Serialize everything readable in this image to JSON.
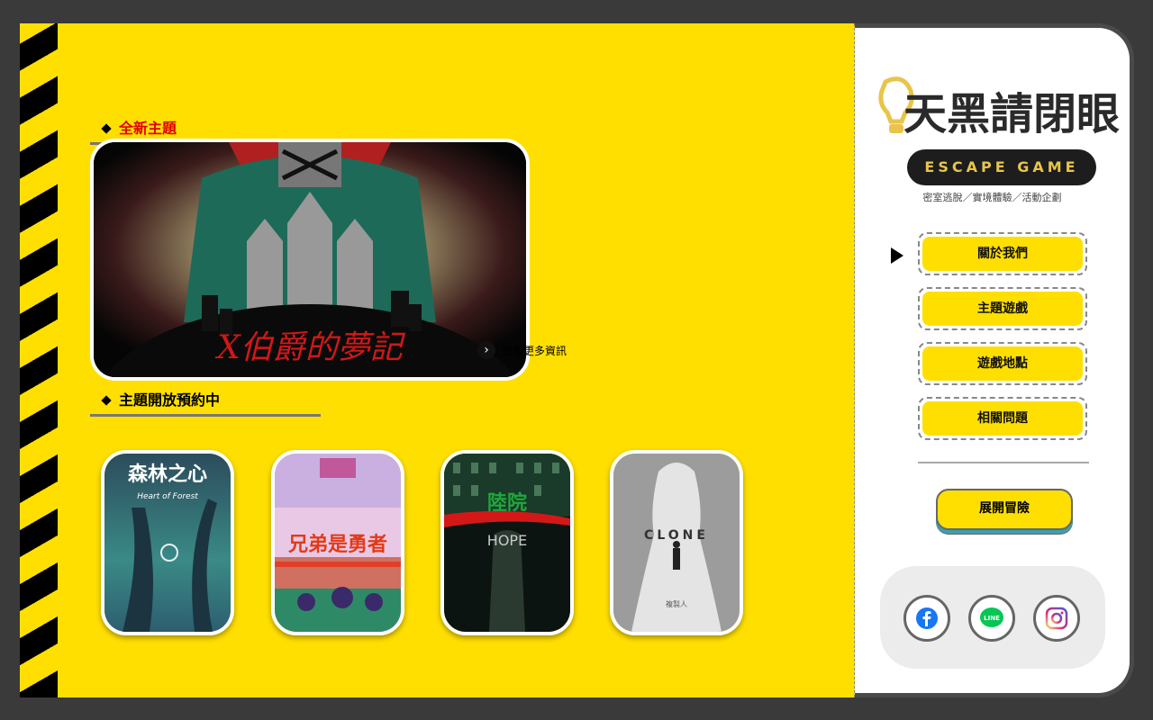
{
  "main": {
    "new_section_title": "全新主題",
    "featured": {
      "title_art": "X伯爵的夢記",
      "more_info": "查看更多資訊",
      "more_icon": "chevron-right-icon"
    },
    "open_section_title": "主題開放預約中",
    "themes": [
      {
        "title": "森林之心",
        "subtitle": "Heart of Forest"
      },
      {
        "title": "兄弟是勇者"
      },
      {
        "title": "陸院",
        "subtitle": "HOPE"
      },
      {
        "title": "CLONE",
        "subtitle": "複製人"
      }
    ]
  },
  "sidebar": {
    "logo_text": "天黑請閉眼",
    "escape_label": "ESCAPE GAME",
    "tagline": "密室逃脫／實境體驗／活動企劃",
    "nav": [
      {
        "label": "關於我們"
      },
      {
        "label": "主題遊戲"
      },
      {
        "label": "遊戲地點"
      },
      {
        "label": "相關問題"
      }
    ],
    "cta_label": "展開冒險",
    "social": [
      {
        "icon": "facebook-icon",
        "color": "#1877f2"
      },
      {
        "icon": "line-icon",
        "color": "#06c755"
      },
      {
        "icon": "instagram-icon",
        "color": "#d62976"
      }
    ]
  },
  "colors": {
    "accent": "#ffdf00",
    "frame": "#3a3a3a"
  }
}
